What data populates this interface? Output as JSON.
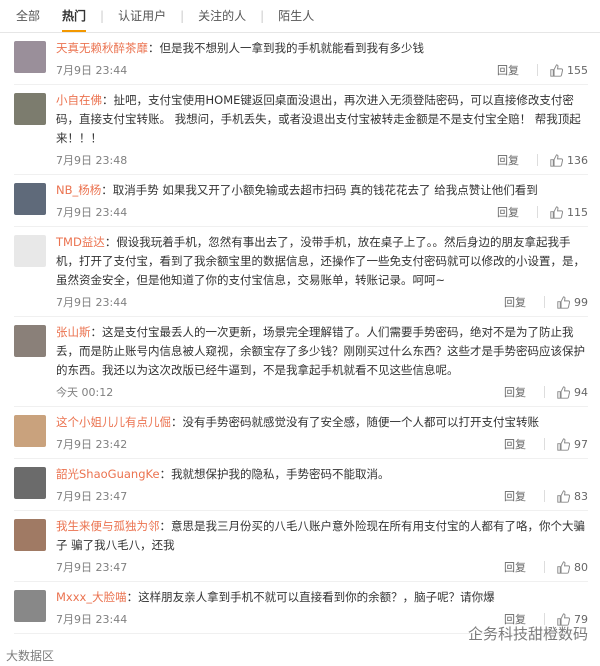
{
  "tabs": [
    "全部",
    "热门",
    "认证用户",
    "关注的人",
    "陌生人"
  ],
  "active_tab": "热门",
  "reply_label": "回复",
  "comments": [
    {
      "name": "天真无赖秋醉茶靡",
      "text": "但是我不想别人一拿到我的手机就能看到我有多少钱",
      "time": "7月9日 23:44",
      "likes": "155",
      "avatar_color": "#9a8f9a"
    },
    {
      "name": "小自在佛",
      "text": "扯吧，支付宝使用HOME键返回桌面没退出，再次进入无须登陆密码，可以直接修改支付密码，直接支付宝转账。 我想问，手机丢失，或者没退出支付宝被转走金额是不是支付宝全赔！ 帮我顶起来！！！",
      "time": "7月9日 23:48",
      "likes": "136",
      "avatar_color": "#7c7c6e"
    },
    {
      "name": "NB_杨杨",
      "text": "取消手势 如果我又开了小额免输或去超市扫码 真的钱花花去了 给我点赞让他们看到",
      "time": "7月9日 23:44",
      "likes": "115",
      "avatar_color": "#5f6a7a"
    },
    {
      "name": "TMD益达",
      "text": "假设我玩着手机，忽然有事出去了，没带手机，放在桌子上了。。然后身边的朋友拿起我手机，打开了支付宝，看到了我余额宝里的数据信息，还操作了一些免支付密码就可以修改的小设置，是，虽然资金安全，但是他知道了你的支付宝信息，交易账单，转账记录。呵呵~",
      "time": "7月9日 23:44",
      "likes": "99",
      "avatar_color": "#e8e8e8"
    },
    {
      "name": "张山斯",
      "text": "这是支付宝最丢人的一次更新，场景完全理解错了。人们需要手势密码，绝对不是为了防止我丢，而是防止账号内信息被人窥视，余额宝存了多少钱？刚刚买过什么东西？这些才是手势密码应该保护的东西。我还以为这次改版已经牛逼到，不是我拿起手机就看不见这些信息呢。",
      "time": "今天 00:12",
      "likes": "94",
      "avatar_color": "#8a8079"
    },
    {
      "name": "这个小姐儿儿有点儿倔",
      "text": "没有手势密码就感觉没有了安全感，随便一个人都可以打开支付宝转账",
      "time": "7月9日 23:42",
      "likes": "97",
      "avatar_color": "#c9a27d"
    },
    {
      "name": "韶光ShaoGuangKe",
      "text": "我就想保护我的隐私，手势密码不能取消。",
      "time": "7月9日 23:47",
      "likes": "83",
      "avatar_color": "#6b6b6b"
    },
    {
      "name": "我生来便与孤独为邻",
      "text": "意思是我三月份买的八毛八账户意外险现在所有用支付宝的人都有了咯，你个大骗子 骗了我八毛八，还我",
      "time": "7月9日 23:47",
      "likes": "80",
      "avatar_color": "#a07a64"
    },
    {
      "name": "Mxxx_大脸喵",
      "text": "这样朋友亲人拿到手机不就可以直接看到你的余额？，脑子呢？请你爆",
      "time": "7月9日 23:44",
      "likes": "79",
      "avatar_color": "#888888"
    }
  ],
  "watermark_right": "企务科技甜橙数码",
  "watermark_left": "大数据区",
  "colors": {
    "name": "#eb7350",
    "accent": "#f39800"
  }
}
